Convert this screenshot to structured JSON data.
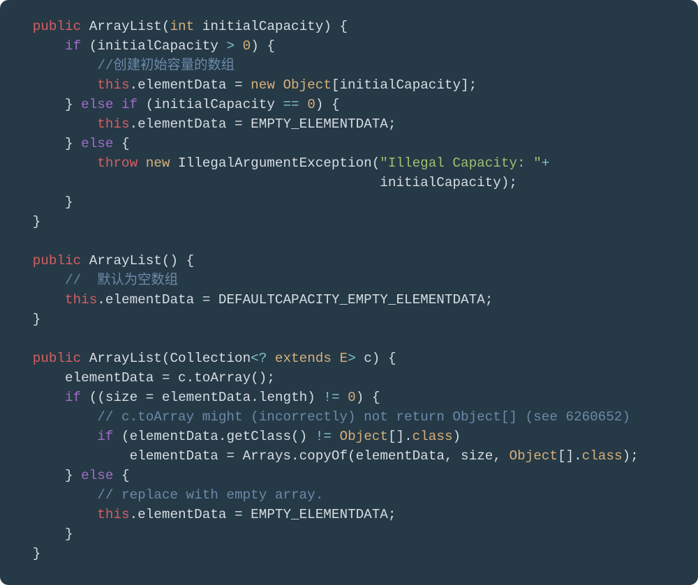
{
  "tokens": {
    "public": "public",
    "int": "int",
    "if": "if",
    "else": "else",
    "this": "this",
    "new": "new",
    "throw": "throw",
    "extends": "extends",
    "ArrayList": "ArrayList",
    "initialCapacity": "initialCapacity",
    "elementData": "elementData",
    "Object": "Object",
    "EMPTY_ELEMENTDATA": "EMPTY_ELEMENTDATA",
    "DEFAULTCAPACITY_EMPTY_ELEMENTDATA": "DEFAULTCAPACITY_EMPTY_ELEMENTDATA",
    "IllegalArgumentException": "IllegalArgumentException",
    "Collection": "Collection",
    "E": "E",
    "c": "c",
    "toArray": "toArray",
    "size": "size",
    "length": "length",
    "getClass": "getClass",
    "class": "class",
    "Arrays": "Arrays",
    "copyOf": "copyOf",
    "zero": "0",
    "gt": ">",
    "eqeq": "==",
    "neq": "!=",
    "plus": "+",
    "qm_wild": "?",
    "comment_create_array": "//创建初始容量的数组",
    "comment_default_empty": "//  默认为空数组",
    "comment_toarray": "// c.toArray might (incorrectly) not return Object[] (see 6260652)",
    "comment_replace_empty": "// replace with empty array.",
    "string_illegal": "\"Illegal Capacity: \""
  }
}
